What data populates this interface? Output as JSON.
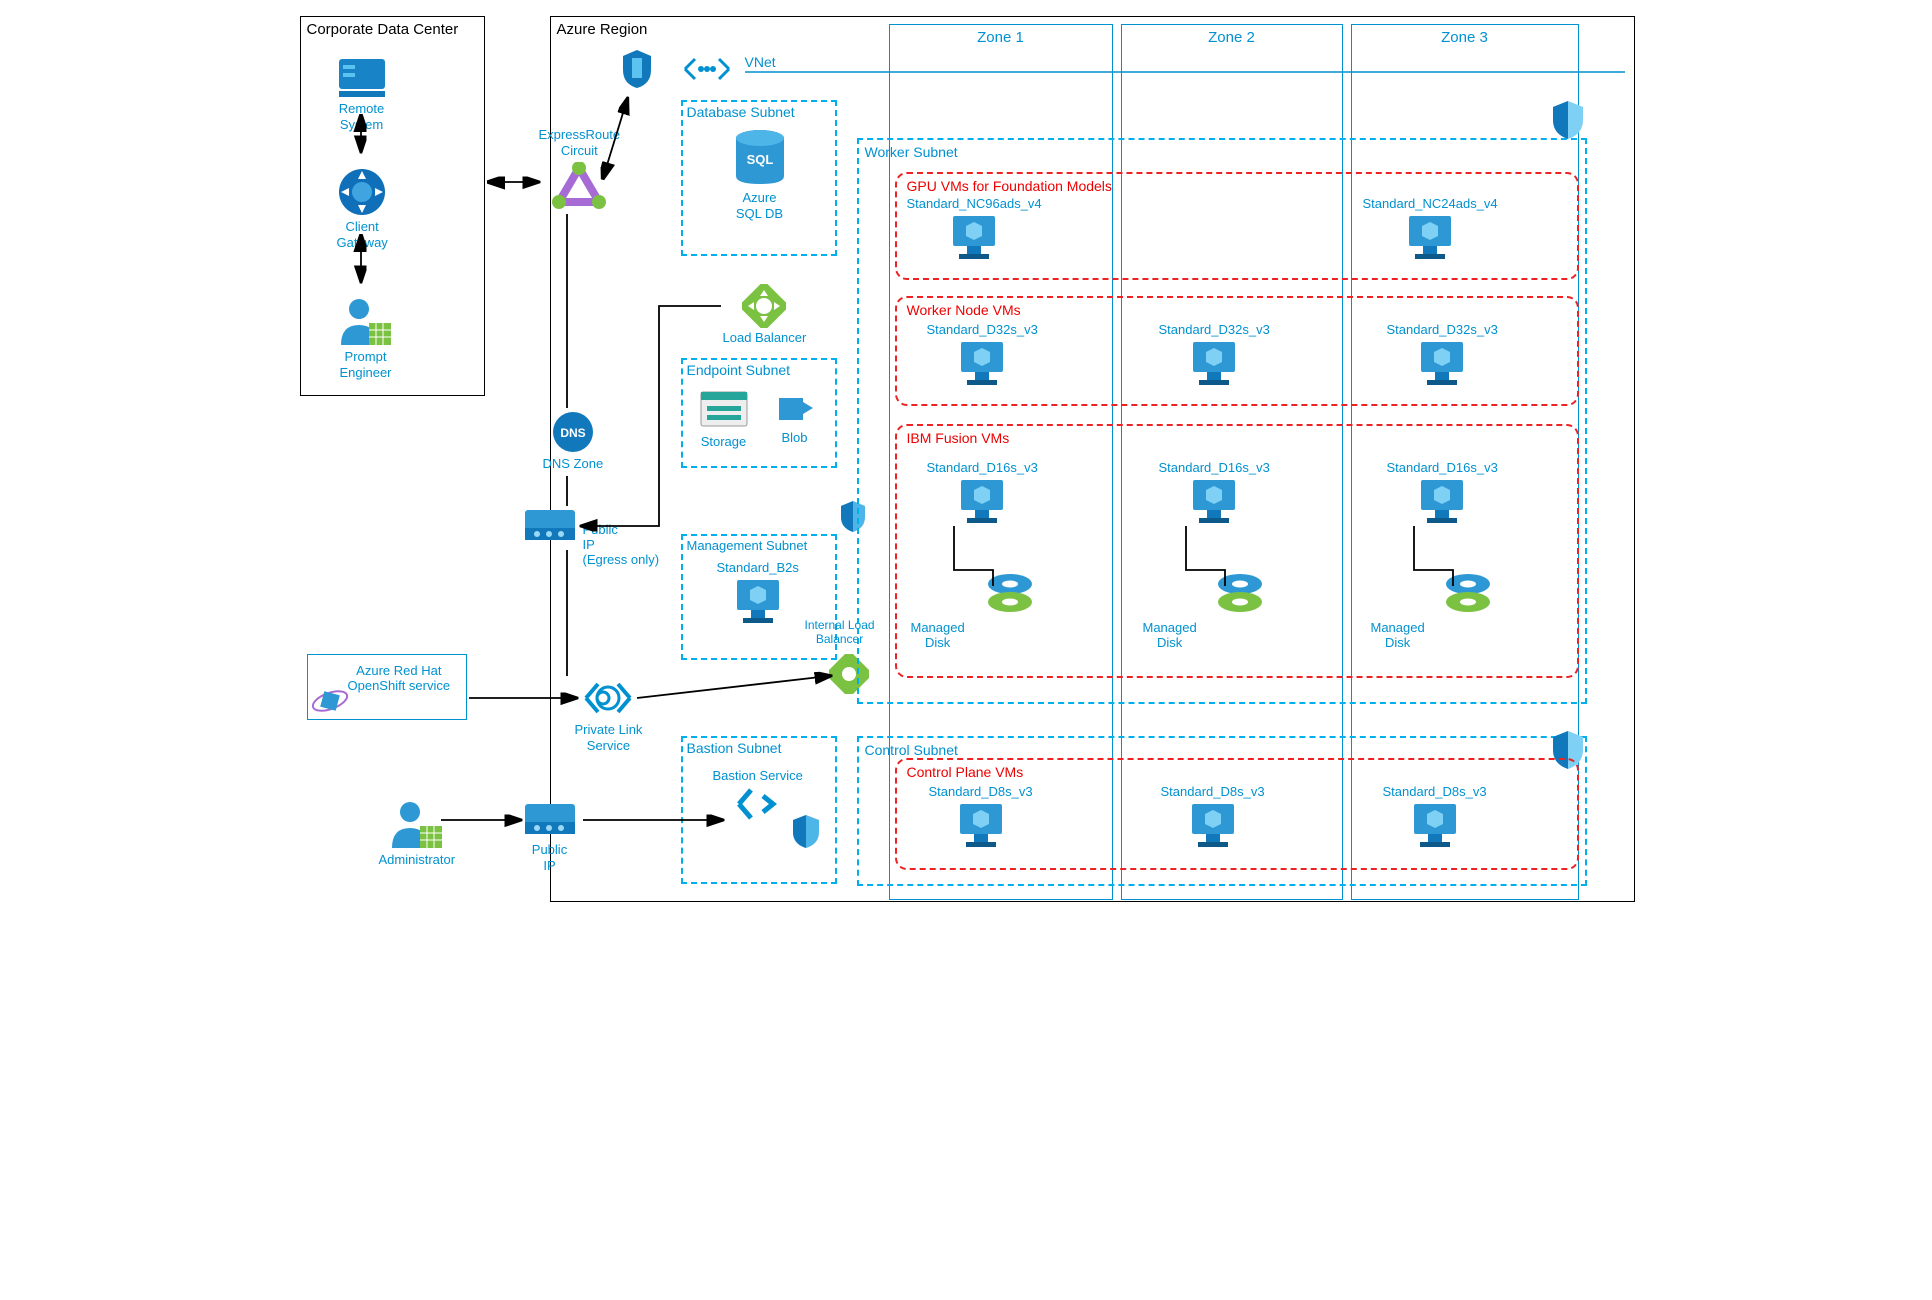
{
  "corp": {
    "title": "Corporate Data Center",
    "remote": "Remote\nSystem",
    "gateway": "Client\nGateway",
    "engineer": "Prompt\nEngineer"
  },
  "azure": {
    "title": "Azure Region",
    "er": "ExpressRoute\nCircuit",
    "dns": "DNS Zone",
    "pip1": "Public\nIP\n(Egress only)",
    "pls": "Private Link\nService",
    "pip2": "Public\nIP",
    "vnet": "VNet",
    "db_sub": "Database Subnet",
    "sql": "Azure\nSQL DB",
    "lb": "Load Balancer",
    "ep_sub": "Endpoint Subnet",
    "storage": "Storage",
    "blob": "Blob",
    "mg_sub": "Management Subnet",
    "mg_vm": "Standard_B2s",
    "ilb": "Internal Load\nBalancer",
    "ba_sub": "Bastion Subnet",
    "ba_svc": "Bastion Service",
    "worker_sub": "Worker Subnet",
    "control_sub": "Control Subnet"
  },
  "zones": [
    "Zone 1",
    "Zone 2",
    "Zone 3"
  ],
  "groups": {
    "gpu": {
      "title": "GPU VMs for Foundation Models",
      "z1": "Standard_NC96ads_v4",
      "z3": "Standard_NC24ads_v4"
    },
    "worker": {
      "title": "Worker Node VMs",
      "vm": "Standard_D32s_v3"
    },
    "fusion": {
      "title": "IBM Fusion VMs",
      "vm": "Standard_D16s_v3",
      "disk": "Managed\nDisk"
    },
    "control": {
      "title": "Control Plane VMs",
      "vm": "Standard_D8s_v3"
    }
  },
  "ext": {
    "aro": "Azure Red Hat\nOpenShift service",
    "admin": "Administrator"
  }
}
